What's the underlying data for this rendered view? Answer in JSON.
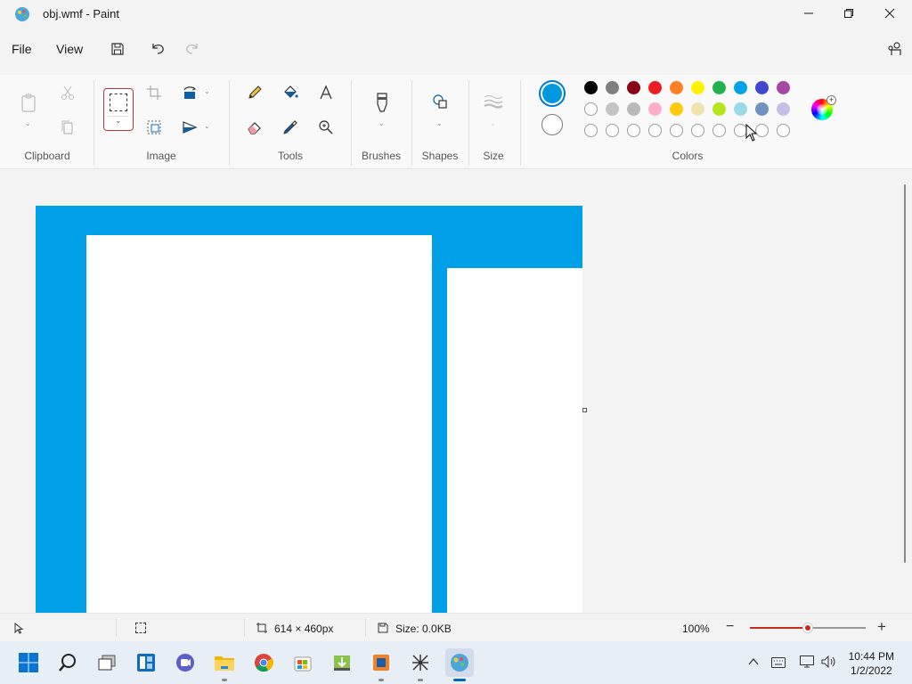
{
  "window": {
    "title": "obj.wmf - Paint"
  },
  "menu": {
    "file": "File",
    "view": "View"
  },
  "ribbon": {
    "groups": {
      "clipboard": "Clipboard",
      "image": "Image",
      "tools": "Tools",
      "brushes": "Brushes",
      "shapes": "Shapes",
      "size": "Size",
      "colors": "Colors"
    },
    "primary_color": "#0099e0",
    "secondary_color": "#ffffff",
    "palette_row1": [
      "#000000",
      "#7f7f7f",
      "#880015",
      "#ed1c24",
      "#ff7f27",
      "#fff200",
      "#22b14c",
      "#00a2e8",
      "#3f48cc",
      "#a349a4"
    ],
    "palette_row2": [
      "#ffffff",
      "#c3c3c3",
      "#b9b9b9",
      "#ffaec9",
      "#ffc90e",
      "#efe4b0",
      "#b5e61d",
      "#99d9ea",
      "#7092be",
      "#c8bfe7"
    ]
  },
  "canvas": {
    "fill_color": "#00a0e8"
  },
  "status": {
    "dimensions": "614 × 460px",
    "size": "Size: 0.0KB",
    "zoom": "100%",
    "zoom_level": 0.5
  },
  "taskbar": {
    "time": "10:44 PM",
    "date": "1/2/2022"
  }
}
